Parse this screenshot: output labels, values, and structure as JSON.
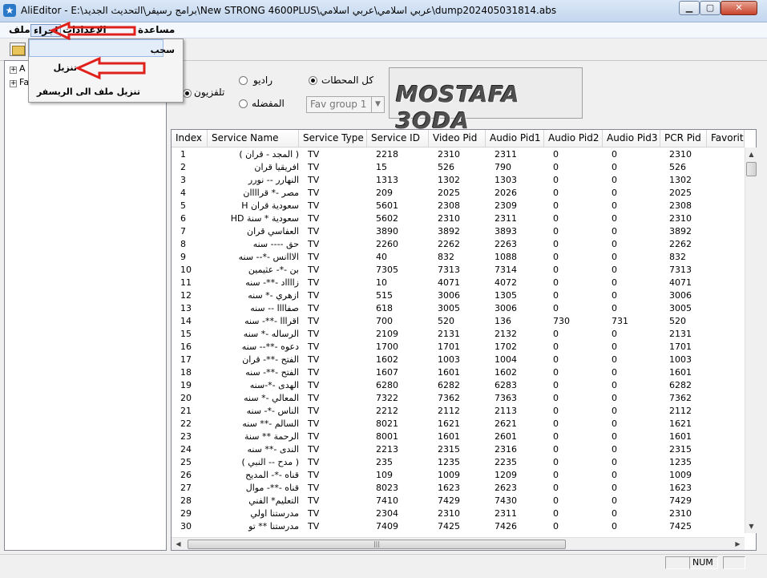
{
  "window": {
    "title": "AliEditor - E:\\برامج رسيفر\\التحديث الجديد\\New STRONG 4600PLUS\\عربي اسلامي\\عربي اسلامي\\dump202405031814.abs",
    "minimize_glyph": "▁",
    "maximize_glyph": "▢",
    "close_glyph": "✕"
  },
  "menubar": {
    "file": "ملف",
    "action": "اجراء",
    "settings": "الإعدادات",
    "help": "مساعدة"
  },
  "action_menu": {
    "items": [
      "سحب",
      "تنزيل",
      "تنزيل ملف الى الريسفر"
    ]
  },
  "tree": {
    "nodes": [
      "A",
      "Fa"
    ]
  },
  "filters": {
    "tv": "تلفزيون",
    "radio": "راديو",
    "all_channels": "كل المحطات",
    "favorites": "المفضله",
    "fav_group": "Fav group 1"
  },
  "logo": {
    "text": "MOSTAFA 3ODA"
  },
  "table": {
    "columns": [
      "Index",
      "Service Name",
      "Service Type",
      "Service ID",
      "Video Pid",
      "Audio Pid1",
      "Audio Pid2",
      "Audio Pid3",
      "PCR Pid",
      "Favorite"
    ],
    "rows": [
      [
        "1",
        "( المجد - قران )",
        "TV",
        "2218",
        "2310",
        "2311",
        "0",
        "0",
        "2310"
      ],
      [
        "2",
        "افريقيا قران",
        "TV",
        "15",
        "526",
        "790",
        "0",
        "0",
        "526"
      ],
      [
        "3",
        "النهارر -- نورر",
        "TV",
        "1313",
        "1302",
        "1303",
        "0",
        "0",
        "1302"
      ],
      [
        "4",
        "مصر -* قراااان",
        "TV",
        "209",
        "2025",
        "2026",
        "0",
        "0",
        "2025"
      ],
      [
        "5",
        "سعودية قران H",
        "TV",
        "5601",
        "2308",
        "2309",
        "0",
        "0",
        "2308"
      ],
      [
        "6",
        "سعودية * سنة HD",
        "TV",
        "5602",
        "2310",
        "2311",
        "0",
        "0",
        "2310"
      ],
      [
        "7",
        "العفاسي قران",
        "TV",
        "3890",
        "3892",
        "3893",
        "0",
        "0",
        "3892"
      ],
      [
        "8",
        "حق ---- سنه",
        "TV",
        "2260",
        "2262",
        "2263",
        "0",
        "0",
        "2262"
      ],
      [
        "9",
        "الااانس -*-- سنه",
        "TV",
        "40",
        "832",
        "1088",
        "0",
        "0",
        "832"
      ],
      [
        "10",
        "بن -*- عثيمين",
        "TV",
        "7305",
        "7313",
        "7314",
        "0",
        "0",
        "7313"
      ],
      [
        "11",
        "زااااد -**- سنه",
        "TV",
        "10",
        "4071",
        "4072",
        "0",
        "0",
        "4071"
      ],
      [
        "12",
        "ازهري -* سنه",
        "TV",
        "515",
        "3006",
        "1305",
        "0",
        "0",
        "3006"
      ],
      [
        "13",
        "صفاااا -- سنه",
        "TV",
        "618",
        "3005",
        "3006",
        "0",
        "0",
        "3005"
      ],
      [
        "14",
        "اقرااا -**- سنه",
        "TV",
        "700",
        "520",
        "136",
        "730",
        "731",
        "520"
      ],
      [
        "15",
        "الرساله -* سنه",
        "TV",
        "2109",
        "2131",
        "2132",
        "0",
        "0",
        "2131"
      ],
      [
        "16",
        "دعوه -**-- سنه",
        "TV",
        "1700",
        "1701",
        "1702",
        "0",
        "0",
        "1701"
      ],
      [
        "17",
        "الفتح -**- قران",
        "TV",
        "1602",
        "1003",
        "1004",
        "0",
        "0",
        "1003"
      ],
      [
        "18",
        "الفتح -**- سنه",
        "TV",
        "1607",
        "1601",
        "1602",
        "0",
        "0",
        "1601"
      ],
      [
        "19",
        "الهدى -*-سنه",
        "TV",
        "6280",
        "6282",
        "6283",
        "0",
        "0",
        "6282"
      ],
      [
        "20",
        "المعالي -* سنه",
        "TV",
        "7322",
        "7362",
        "7363",
        "0",
        "0",
        "7362"
      ],
      [
        "21",
        "الناس -*- سنه",
        "TV",
        "2212",
        "2112",
        "2113",
        "0",
        "0",
        "2112"
      ],
      [
        "22",
        "السالم -** سنه",
        "TV",
        "8021",
        "1621",
        "2621",
        "0",
        "0",
        "1621"
      ],
      [
        "23",
        "الرحمة ** سنة",
        "TV",
        "8001",
        "1601",
        "2601",
        "0",
        "0",
        "1601"
      ],
      [
        "24",
        "الندى -** سنه",
        "TV",
        "2213",
        "2315",
        "2316",
        "0",
        "0",
        "2315"
      ],
      [
        "25",
        "( مدح -- النبي )",
        "TV",
        "235",
        "1235",
        "2235",
        "0",
        "0",
        "1235"
      ],
      [
        "26",
        "قناه -*- المديح",
        "TV",
        "109",
        "1009",
        "1209",
        "0",
        "0",
        "1009"
      ],
      [
        "27",
        "قناه -**- موال",
        "TV",
        "8023",
        "1623",
        "2623",
        "0",
        "0",
        "1623"
      ],
      [
        "28",
        "التعليم* الفني",
        "TV",
        "7410",
        "7429",
        "7430",
        "0",
        "0",
        "7429"
      ],
      [
        "29",
        "مدرستنا اولي",
        "TV",
        "2304",
        "2310",
        "2311",
        "0",
        "0",
        "2310"
      ],
      [
        "30",
        "مدرستنا ** تو",
        "TV",
        "7409",
        "7425",
        "7426",
        "0",
        "0",
        "7425"
      ]
    ]
  },
  "statusbar": {
    "num": "NUM"
  },
  "colors": {
    "annotation_red": "#e0201a"
  }
}
